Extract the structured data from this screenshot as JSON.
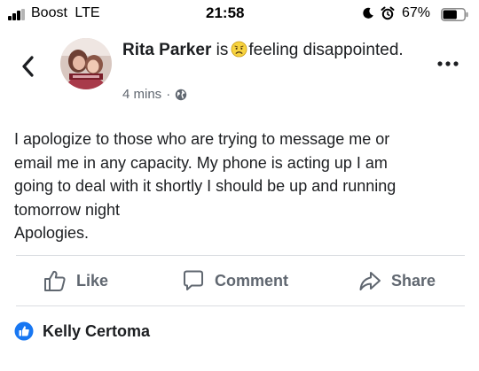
{
  "status_bar": {
    "carrier": "Boost",
    "network": "LTE",
    "time": "21:58",
    "battery_percent": "67%",
    "battery_level": 0.67,
    "icons": [
      "signal-icon",
      "moon-icon",
      "alarm-icon",
      "battery-icon"
    ]
  },
  "header": {
    "back_icon": "chevron-left-icon",
    "author_name": "Rita Parker",
    "is_word": "is",
    "feeling_emoji": "disappointed-face-emoji",
    "feeling_text": "feeling disappointed.",
    "time_ago": "4 mins",
    "separator": "·",
    "privacy_icon": "globe-icon",
    "more_icon": "more-horizontal-icon"
  },
  "post": {
    "lines": [
      "I apologize to those who are trying to message me or",
      "email me in any capacity. My phone is acting up I am",
      "going to deal with it shortly I should be up and running",
      "tomorrow night",
      "Apologies."
    ]
  },
  "actions": {
    "like_label": "Like",
    "comment_label": "Comment",
    "share_label": "Share"
  },
  "reactions": {
    "icon": "like-badge-icon",
    "name": "Kelly Certoma"
  },
  "colors": {
    "text_primary": "#1c1e21",
    "text_secondary": "#606770",
    "like_blue": "#1877f2",
    "divider": "#dadde1"
  }
}
